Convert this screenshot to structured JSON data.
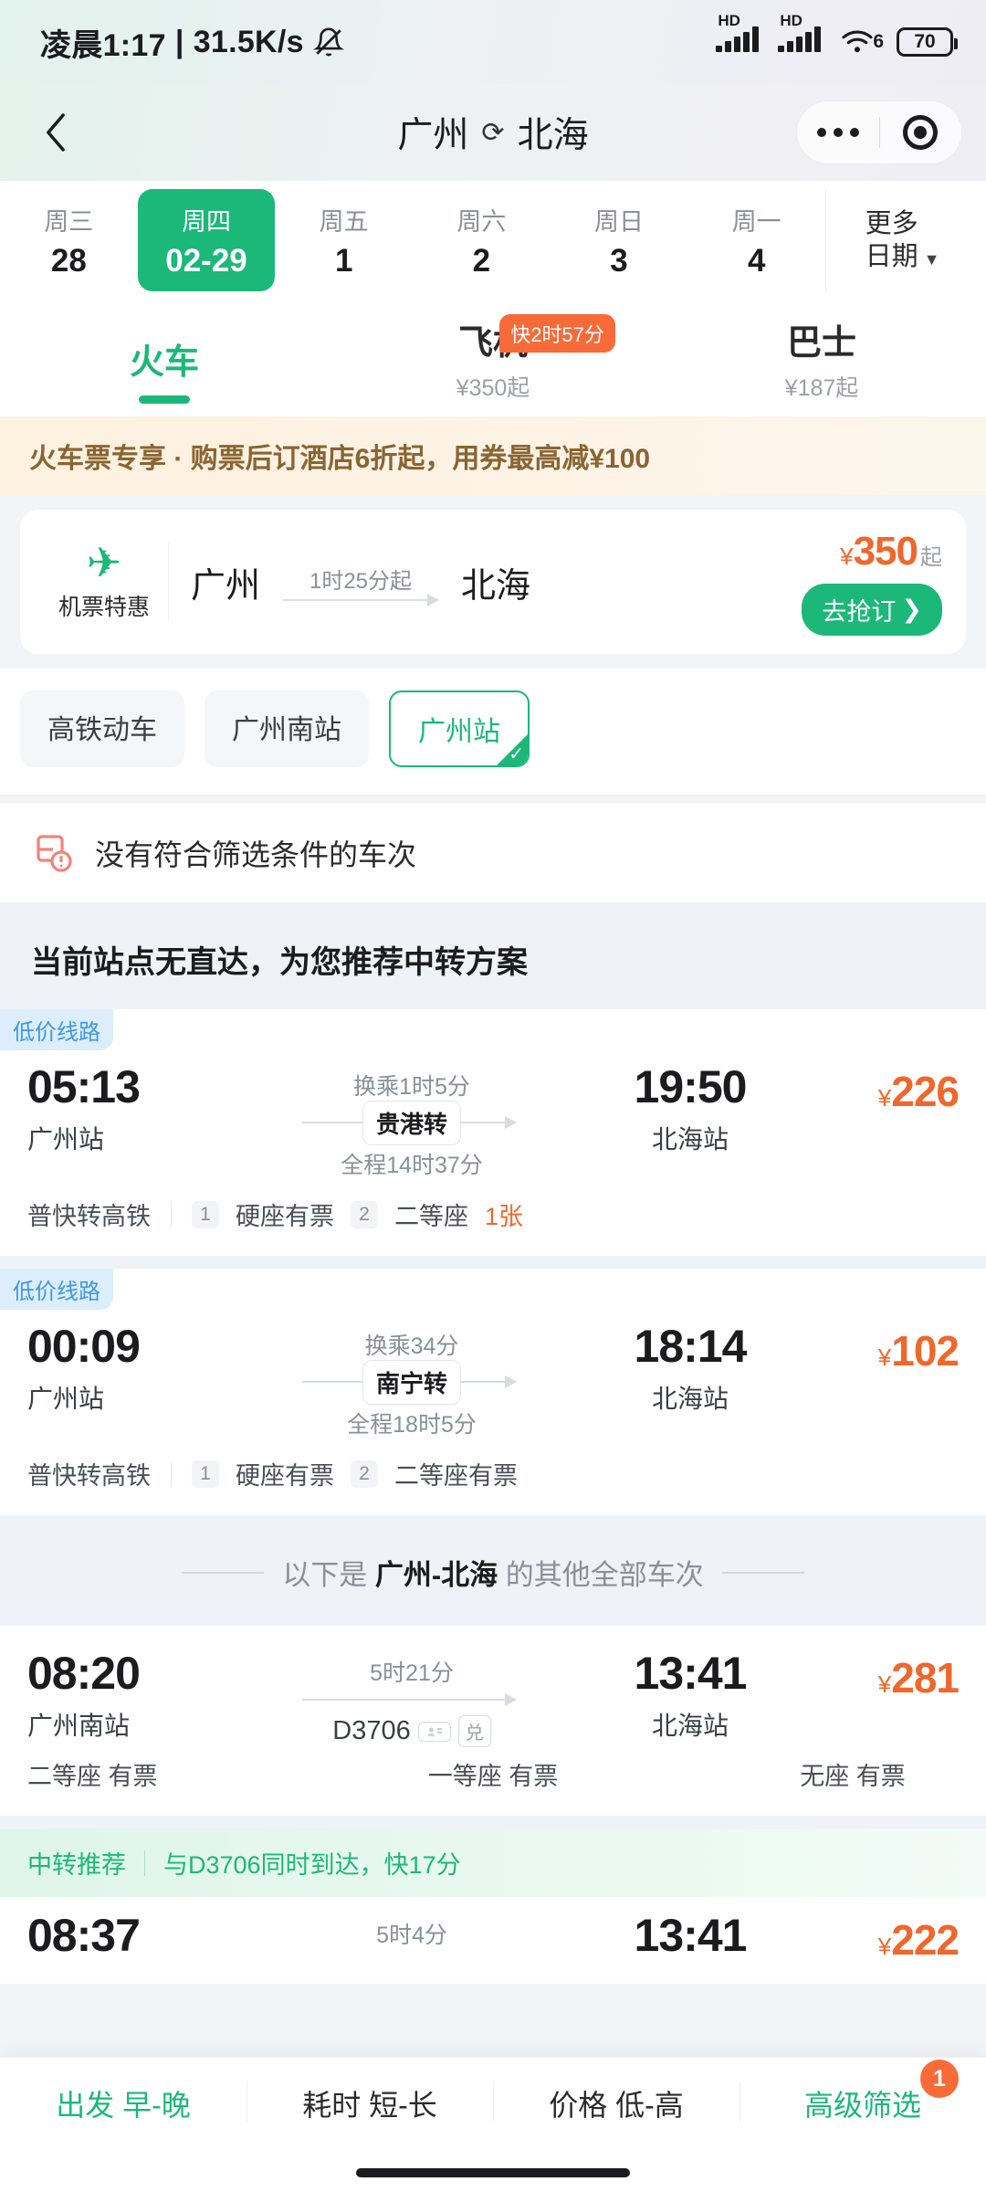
{
  "status_bar": {
    "time": "凌晨1:17",
    "separator": "|",
    "net_speed": "31.5K/s",
    "mute_icon": "bell-muted-icon",
    "signal_1_label": "HD",
    "signal_2_label": "HD",
    "wifi_label": "6",
    "battery_level": "70"
  },
  "header": {
    "back_icon": "chevron-left-icon",
    "origin": "广州",
    "swap_icon": "⟳",
    "destination": "北海",
    "capsule_more_icon": "more-dots-icon",
    "capsule_target_icon": "target-icon"
  },
  "dates": {
    "items": [
      {
        "weekday": "周三",
        "day": "28",
        "selected": false
      },
      {
        "weekday": "周四",
        "day": "02-29",
        "selected": true
      },
      {
        "weekday": "周五",
        "day": "1",
        "selected": false
      },
      {
        "weekday": "周六",
        "day": "2",
        "selected": false
      },
      {
        "weekday": "周日",
        "day": "3",
        "selected": false
      },
      {
        "weekday": "周一",
        "day": "4",
        "selected": false
      }
    ],
    "more_line1": "更多",
    "more_line2": "日期",
    "more_caret": "▼"
  },
  "transport_tabs": [
    {
      "label": "火车",
      "sub": "",
      "badge": "",
      "active": true
    },
    {
      "label": "飞机",
      "sub": "¥350起",
      "badge": "快2时57分",
      "active": false
    },
    {
      "label": "巴士",
      "sub": "¥187起",
      "badge": "",
      "active": false
    }
  ],
  "promo_banner": {
    "text": "火车票专享 · 购票后订酒店6折起，用券最高减¥100"
  },
  "flight_card": {
    "icon": "airplane-icon",
    "icon_label": "机票特惠",
    "origin": "广州",
    "duration": "1时25分起",
    "destination": "北海",
    "currency": "¥",
    "price": "350",
    "price_suffix": "起",
    "cta": "去抢订",
    "cta_arrow": "❯"
  },
  "filter_chips": [
    {
      "label": "高铁动车",
      "selected": false
    },
    {
      "label": "广州南站",
      "selected": false
    },
    {
      "label": "广州站",
      "selected": true
    }
  ],
  "no_result": {
    "icon": "no-train-alert-icon",
    "text": "没有符合筛选条件的车次"
  },
  "transfer_section": {
    "heading": "当前站点无直达，为您推荐中转方案",
    "items": [
      {
        "tag": "低价线路",
        "depart_time": "05:13",
        "depart_station": "广州站",
        "transfer_wait": "换乘1时5分",
        "transfer_station": "贵港转",
        "total_duration": "全程14时37分",
        "arrive_time": "19:50",
        "arrive_station": "北海站",
        "currency": "¥",
        "price": "226",
        "train_type": "普快转高铁",
        "seats": [
          {
            "leg": "1",
            "name": "硬座有票",
            "remain": ""
          },
          {
            "leg": "2",
            "name": "二等座",
            "remain": "1张"
          }
        ]
      },
      {
        "tag": "低价线路",
        "depart_time": "00:09",
        "depart_station": "广州站",
        "transfer_wait": "换乘34分",
        "transfer_station": "南宁转",
        "total_duration": "全程18时5分",
        "arrive_time": "18:14",
        "arrive_station": "北海站",
        "currency": "¥",
        "price": "102",
        "train_type": "普快转高铁",
        "seats": [
          {
            "leg": "1",
            "name": "硬座有票",
            "remain": ""
          },
          {
            "leg": "2",
            "name": "二等座有票",
            "remain": ""
          }
        ]
      }
    ]
  },
  "all_trains_divider": {
    "prefix": "以下是 ",
    "route": "广州-北海",
    "suffix": " 的其他全部车次"
  },
  "direct_train": {
    "depart_time": "08:20",
    "depart_station": "广州南站",
    "duration": "5时21分",
    "train_no": "D3706",
    "badge_id_icon": "id-card-icon",
    "badge_redeem": "兑",
    "arrive_time": "13:41",
    "arrive_station": "北海站",
    "currency": "¥",
    "price": "281",
    "seats": [
      {
        "name": "二等座",
        "status": "有票"
      },
      {
        "name": "一等座",
        "status": "有票"
      },
      {
        "name": "无座",
        "status": "有票"
      }
    ]
  },
  "transfer_recommend": {
    "tag": "中转推荐",
    "text": "与D3706同时到达，快17分",
    "depart_time": "08:37",
    "duration": "5时4分",
    "arrive_time": "13:41",
    "currency": "¥",
    "price": "222"
  },
  "bottom_bar": {
    "items": [
      {
        "label": "出发 早-晚",
        "active": true,
        "badge": ""
      },
      {
        "label": "耗时 短-长",
        "active": false,
        "badge": ""
      },
      {
        "label": "价格 低-高",
        "active": false,
        "badge": ""
      },
      {
        "label": "高级筛选",
        "active": true,
        "badge": "1"
      }
    ]
  },
  "colors": {
    "accent_green": "#1CB87A",
    "price_orange": "#F0672B",
    "badge_orange": "#F86A38",
    "lowprice_blue": "#3F97E6",
    "promo_brown": "#8A6432"
  }
}
